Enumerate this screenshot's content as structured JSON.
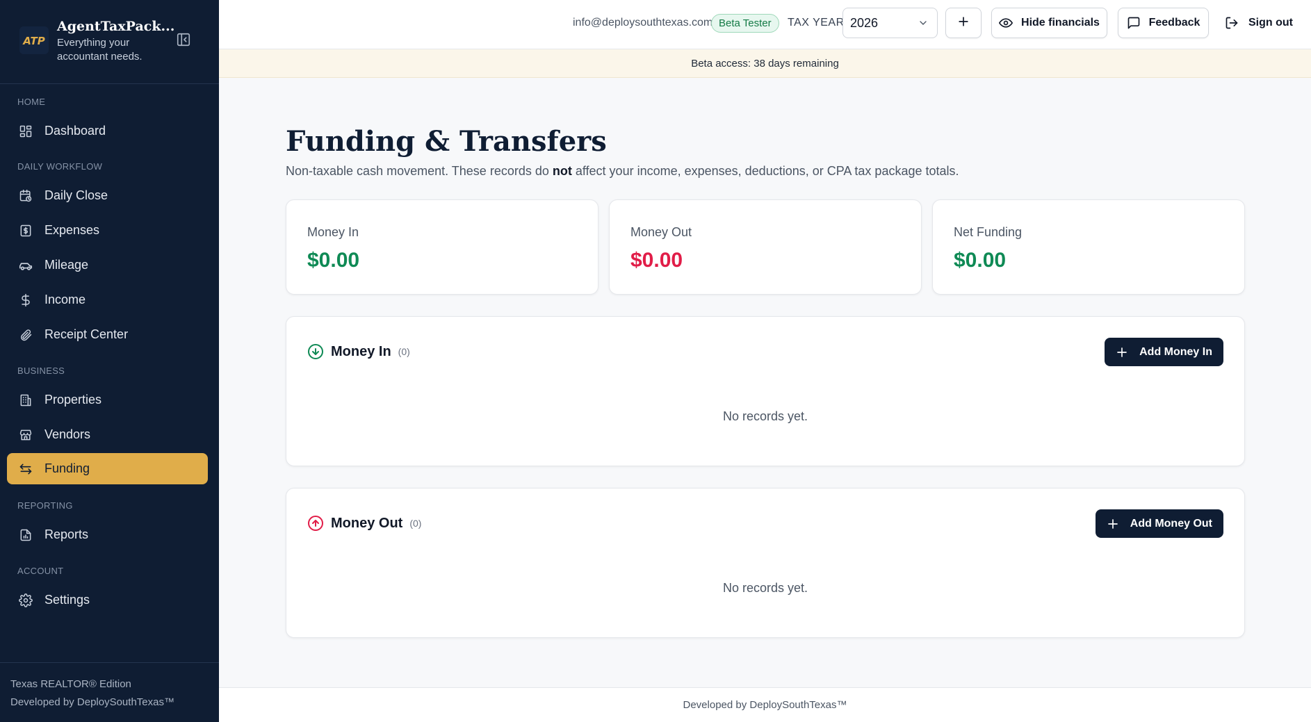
{
  "sidebar": {
    "brand_name": "AgentTaxPack...",
    "brand_tagline": "Everything your accountant needs.",
    "logo_text": "ATP",
    "sections": {
      "home": "HOME",
      "daily_workflow": "DAILY WORKFLOW",
      "business": "BUSINESS",
      "reporting": "REPORTING",
      "account": "ACCOUNT"
    },
    "items": {
      "dashboard": "Dashboard",
      "daily_close": "Daily Close",
      "expenses": "Expenses",
      "mileage": "Mileage",
      "income": "Income",
      "receipt_center": "Receipt Center",
      "properties": "Properties",
      "vendors": "Vendors",
      "funding": "Funding",
      "reports": "Reports",
      "settings": "Settings"
    },
    "active_item": "Funding",
    "footer_edition": "Texas REALTOR® Edition",
    "footer_developer": "Developed by DeploySouthTexas™"
  },
  "topbar": {
    "email": "info@deploysouthtexas.com",
    "badge": "Beta Tester",
    "tax_year_label": "TAX YEAR",
    "tax_year_value": "2026",
    "add_label": "+",
    "hide_financials": "Hide financials",
    "feedback": "Feedback",
    "sign_out": "Sign out"
  },
  "beta_banner": "Beta access: 38 days remaining",
  "page": {
    "title": "Funding & Transfers",
    "subtitle_before": "Non-taxable cash movement. These records do ",
    "subtitle_bold": "not",
    "subtitle_after": " affect your income, expenses, deductions, or CPA tax package totals."
  },
  "stats": {
    "money_in": {
      "label": "Money In",
      "value": "$0.00"
    },
    "money_out": {
      "label": "Money Out",
      "value": "$0.00"
    },
    "net_funding": {
      "label": "Net Funding",
      "value": "$0.00"
    }
  },
  "money_in_panel": {
    "title": "Money In",
    "count": "(0)",
    "button": "Add Money In",
    "empty": "No records yet."
  },
  "money_out_panel": {
    "title": "Money Out",
    "count": "(0)",
    "button": "Add Money Out",
    "empty": "No records yet."
  },
  "footer": "Developed by DeploySouthTexas™",
  "colors": {
    "sidebar_bg": "#0f1d33",
    "accent_gold": "#e0ad4a",
    "positive_green": "#0f8a55",
    "negative_red": "#e11d48",
    "dark_button": "#0f1d33"
  }
}
